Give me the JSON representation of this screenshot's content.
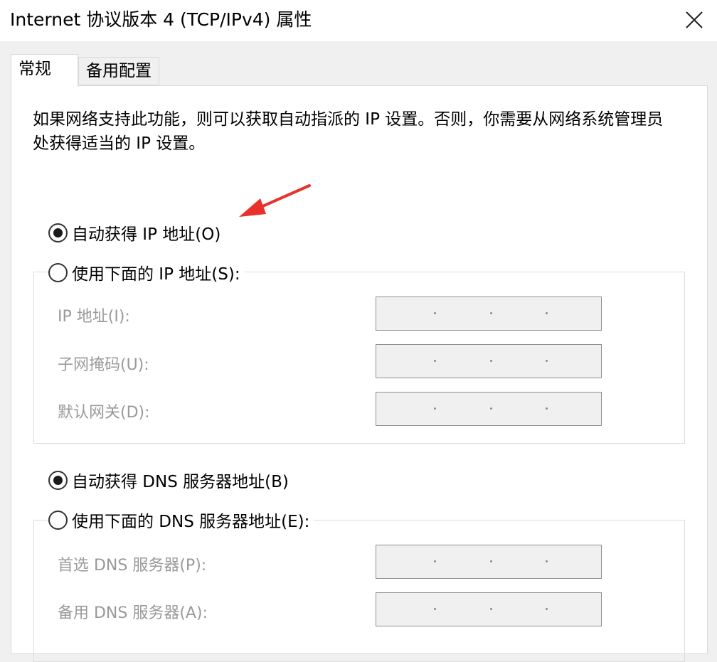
{
  "window": {
    "title": "Internet 协议版本 4 (TCP/IPv4) 属性",
    "close_icon": "close-icon"
  },
  "tabs": [
    {
      "label": "常规",
      "active": true
    },
    {
      "label": "备用配置",
      "active": false
    }
  ],
  "description": "如果网络支持此功能，则可以获取自动指派的 IP 设置。否则，你需要从网络系统管理员处获得适当的 IP 设置。",
  "ip_section": {
    "auto_label": "自动获得 IP 地址(O)",
    "auto_checked": true,
    "manual_label": "使用下面的 IP 地址(S):",
    "manual_checked": false,
    "fields": [
      {
        "label": "IP 地址(I):",
        "value": ""
      },
      {
        "label": "子网掩码(U):",
        "value": ""
      },
      {
        "label": "默认网关(D):",
        "value": ""
      }
    ]
  },
  "dns_section": {
    "auto_label": "自动获得 DNS 服务器地址(B)",
    "auto_checked": true,
    "manual_label": "使用下面的 DNS 服务器地址(E):",
    "manual_checked": false,
    "fields": [
      {
        "label": "首选 DNS 服务器(P):",
        "value": ""
      },
      {
        "label": "备用 DNS 服务器(A):",
        "value": ""
      }
    ]
  },
  "colors": {
    "annotation_arrow": "#e8312a",
    "disabled_text": "#9a9a9a"
  }
}
